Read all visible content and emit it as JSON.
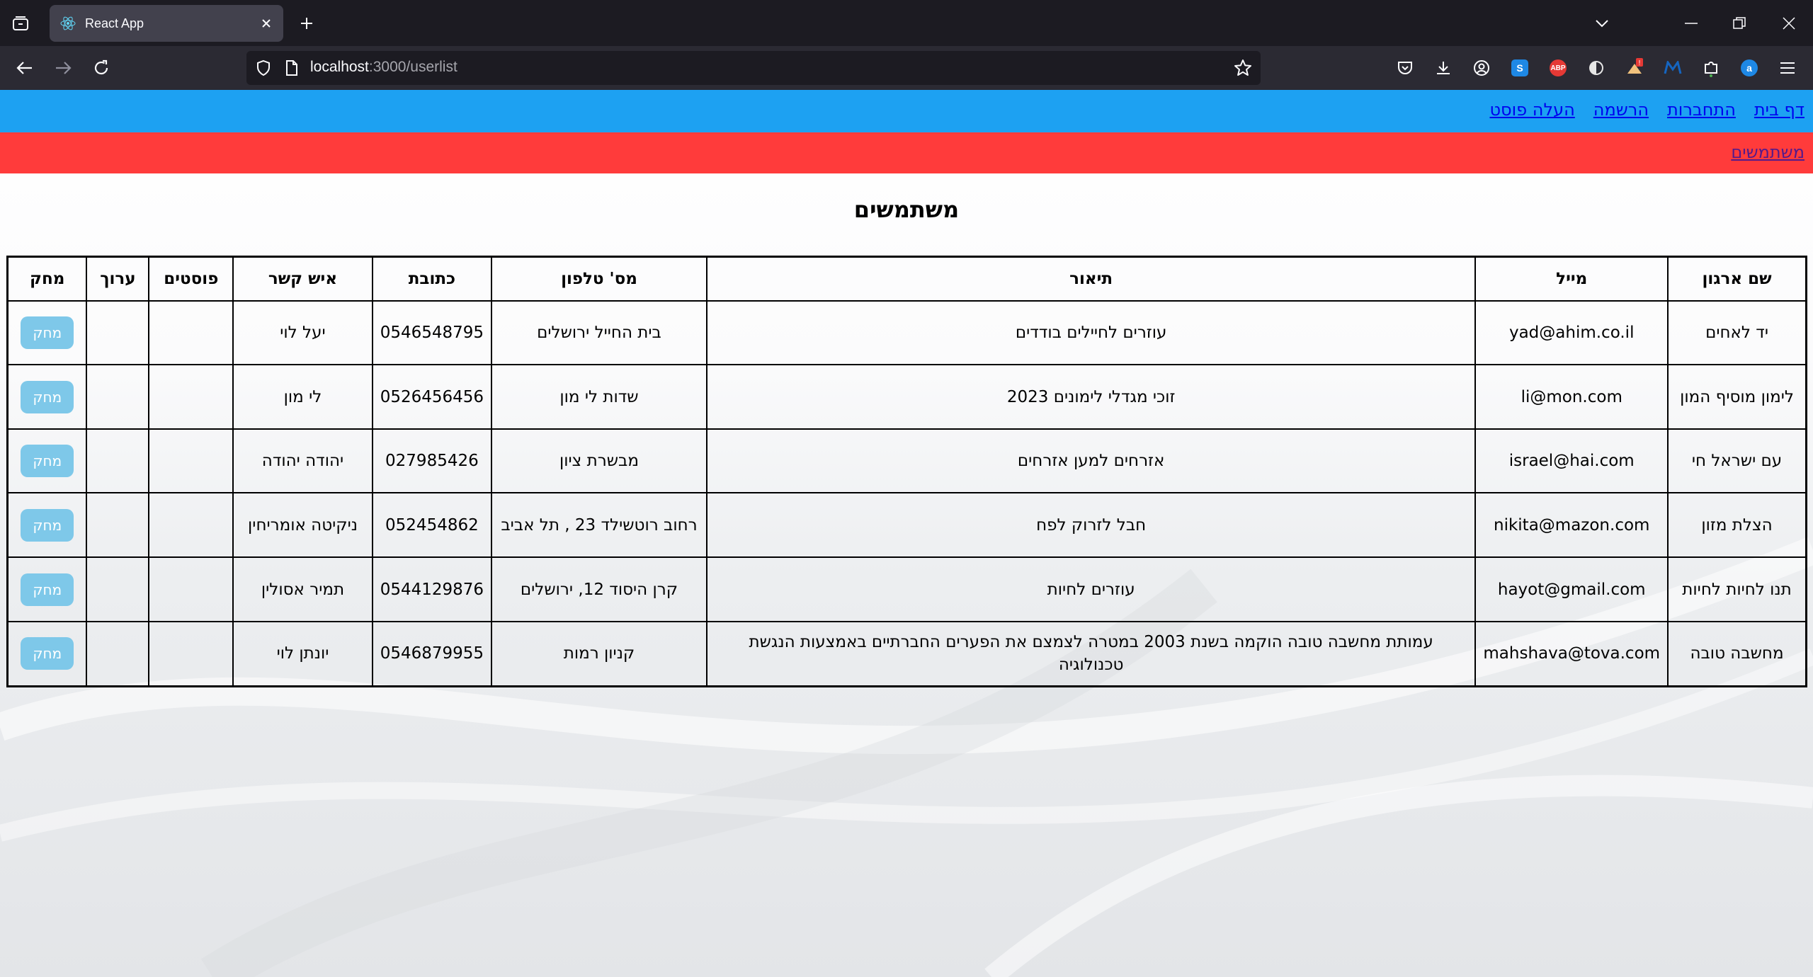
{
  "browser": {
    "tab_title": "React App",
    "url_host": "localhost",
    "url_path": ":3000/userlist"
  },
  "nav": {
    "links": [
      "דף בית",
      "התחברות",
      "הרשמה",
      "העלה פוסט"
    ],
    "sub_link": "משתמשים"
  },
  "page": {
    "title": "משתמשים"
  },
  "table": {
    "headers": {
      "org": "שם ארגון",
      "email": "מייל",
      "desc": "תיאור",
      "phone": "מס' טלפון",
      "address": "כתובת",
      "contact": "איש קשר",
      "posts": "פוסטים",
      "edit": "ערוך",
      "delete": "מחק"
    },
    "delete_label": "מחק",
    "rows": [
      {
        "org": "יד לאחים",
        "email": "yad@ahim.co.il",
        "desc": "עוזרים לחיילים בודדים",
        "address": "בית החייל ירושלים",
        "phone": "0546548795",
        "contact": "יעל לוי",
        "posts": "",
        "edit": ""
      },
      {
        "org": "לימון מוסיף המון",
        "email": "li@mon.com",
        "desc": "זוכי מגדלי לימונים 2023",
        "address": "שדות לי מון",
        "phone": "0526456456",
        "contact": "לי מון",
        "posts": "",
        "edit": ""
      },
      {
        "org": "עם ישראל חי",
        "email": "israel@hai.com",
        "desc": "אזרחים למען אזרחים",
        "address": "מבשרת ציון",
        "phone": "027985426",
        "contact": "יהודה יהודה",
        "posts": "",
        "edit": ""
      },
      {
        "org": "הצלת מזון",
        "email": "nikita@mazon.com",
        "desc": "חבל לזרוק לפח",
        "address": "רחוב רוטשילד 23 , תל אביב",
        "phone": "052454862",
        "contact": "ניקיטה אומריחין",
        "posts": "",
        "edit": ""
      },
      {
        "org": "תנו לחיות לחיות",
        "email": "hayot@gmail.com",
        "desc": "עוזרים לחיות",
        "address": "קרן היסוד 12, ירושלים",
        "phone": "0544129876",
        "contact": "תמיר אסולין",
        "posts": "",
        "edit": ""
      },
      {
        "org": "מחשבה טובה",
        "email": "mahshava@tova.com",
        "desc": "עמותת מחשבה טובה הוקמה בשנת 2003 במטרה לצמצם את הפערים החברתיים באמצעות הנגשת טכנולוגיה",
        "address": "קניון רמות",
        "phone": "0546879955",
        "contact": "יונתן לוי",
        "posts": "",
        "edit": ""
      }
    ]
  },
  "colors": {
    "top_nav": "#1da1f2",
    "sub_nav": "#ff3b3b",
    "delete_button": "#7ec8e9",
    "link": "#0000ee",
    "visited_link": "#551a8b"
  }
}
